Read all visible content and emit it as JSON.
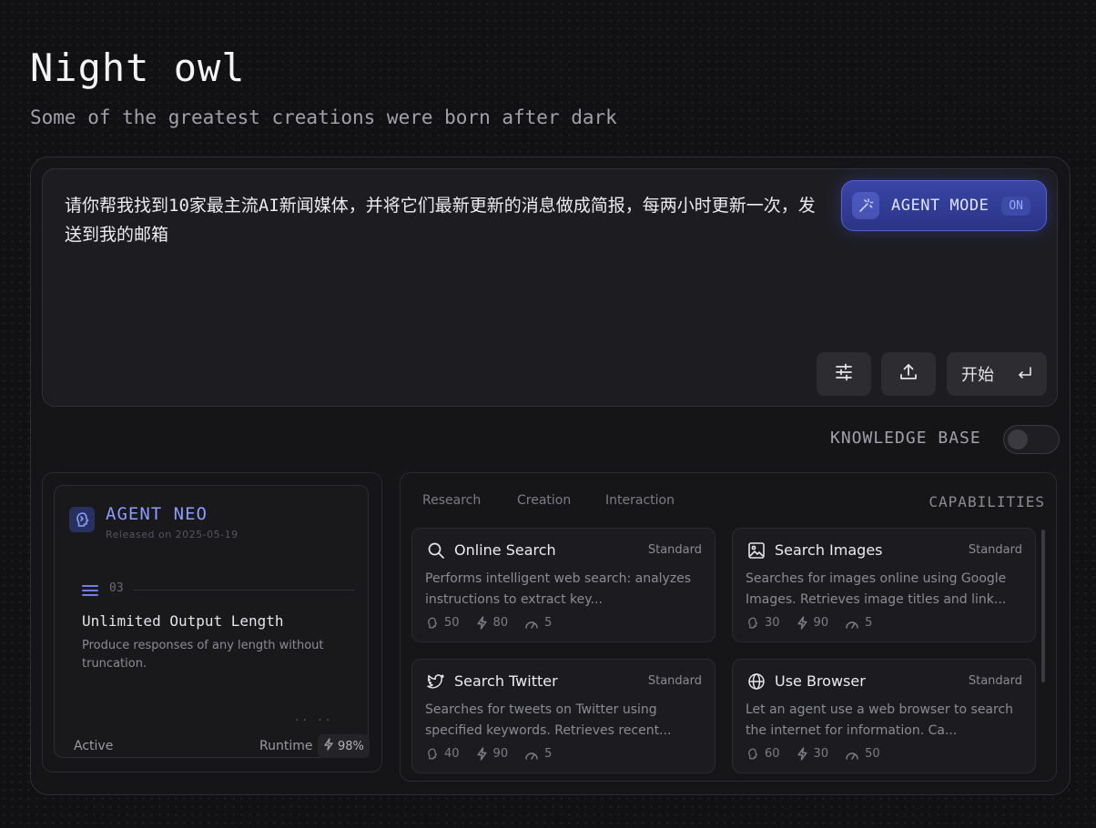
{
  "header": {
    "title": "Night owl",
    "subtitle": "Some of the greatest creations were born after dark"
  },
  "prompt": {
    "text": "请你帮我找到10家最主流AI新闻媒体，并将它们最新更新的消息做成简报，每两小时更新一次，发送到我的邮箱",
    "agent_mode_label": "AGENT MODE",
    "agent_mode_state": "ON",
    "start_label": "开始",
    "start_icon": "enter-icon",
    "settings_icon": "sliders-icon",
    "upload_icon": "upload-icon"
  },
  "knowledge_base": {
    "label": "KNOWLEDGE BASE",
    "enabled": false
  },
  "agent": {
    "name": "AGENT NEO",
    "released": "Released on 2025-05-19",
    "feature": {
      "number": "03",
      "title": "Unlimited Output Length",
      "description": "Produce responses of any length without truncation."
    },
    "dots": "·· ··",
    "status": "Active",
    "runtime_label": "Runtime",
    "runtime_value": "98%",
    "accent_color": "#8a9cff"
  },
  "capabilities": {
    "heading": "CAPABILITIES",
    "tabs": [
      "Research",
      "Creation",
      "Interaction"
    ],
    "items": [
      {
        "title": "Online Search",
        "tier": "Standard",
        "icon": "search-icon",
        "description": "Performs intelligent web search: analyzes instructions to extract key...",
        "stats": [
          "50",
          "80",
          "5"
        ]
      },
      {
        "title": "Search Images",
        "tier": "Standard",
        "icon": "image-icon",
        "description": "Searches for images online using Google Images. Retrieves image titles and link...",
        "stats": [
          "30",
          "90",
          "5"
        ]
      },
      {
        "title": "Search Twitter",
        "tier": "Standard",
        "icon": "twitter-icon",
        "description": "Searches for tweets on Twitter using specified keywords. Retrieves recent...",
        "stats": [
          "40",
          "90",
          "5"
        ]
      },
      {
        "title": "Use Browser",
        "tier": "Standard",
        "icon": "globe-icon",
        "description": "Let an agent use a web browser to search the internet for information. Ca...",
        "stats": [
          "60",
          "30",
          "50"
        ]
      }
    ]
  }
}
